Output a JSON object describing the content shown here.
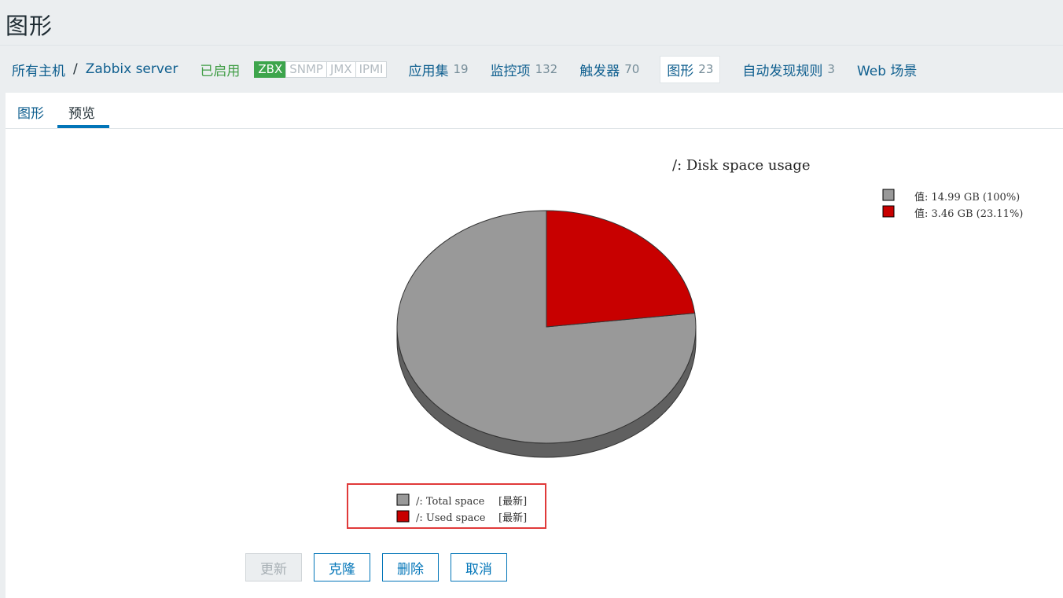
{
  "page": {
    "title": "图形"
  },
  "breadcrumb": {
    "all_hosts": "所有主机",
    "separator": "/",
    "host": "Zabbix server"
  },
  "host_status": "已启用",
  "availability": [
    "ZBX",
    "SNMP",
    "JMX",
    "IPMI"
  ],
  "host_nav": {
    "applications": {
      "label": "应用集",
      "count": "19"
    },
    "items": {
      "label": "监控项",
      "count": "132"
    },
    "triggers": {
      "label": "触发器",
      "count": "70"
    },
    "graphs": {
      "label": "图形",
      "count": "23"
    },
    "discovery": {
      "label": "自动发现规则",
      "count": "3"
    },
    "web": {
      "label": "Web 场景"
    }
  },
  "tabs": [
    {
      "label": "图形"
    },
    {
      "label": "预览"
    }
  ],
  "colors": {
    "total": "#999999",
    "used": "#C80000",
    "total_side": "#606060",
    "used_side": "#960000"
  },
  "chart_data": {
    "type": "pie",
    "title": "/: Disk space usage",
    "series": [
      {
        "name": "/: Total space",
        "func": "[最新]",
        "value": 14.99,
        "unit": "GB",
        "legend_value": "值: 14.99 GB (100%)"
      },
      {
        "name": "/: Used space",
        "func": "[最新]",
        "value": 3.46,
        "unit": "GB",
        "legend_value": "值: 3.46 GB (23.11%)"
      }
    ],
    "slices": [
      {
        "name": "/: Total space",
        "percent": 76.89
      },
      {
        "name": "/: Used space",
        "percent": 23.11
      }
    ],
    "style": "3d"
  },
  "buttons": {
    "update": "更新",
    "clone": "克隆",
    "delete": "删除",
    "cancel": "取消"
  }
}
